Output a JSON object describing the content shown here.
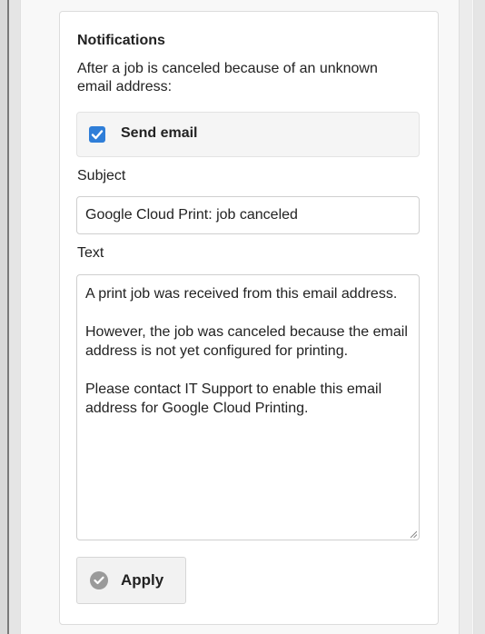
{
  "notifications": {
    "heading": "Notifications",
    "intro": "After a job is canceled because of an unknown email address:",
    "send_email": {
      "label": "Send email",
      "checked": true
    },
    "subject": {
      "label": "Subject",
      "value": "Google Cloud Print: job canceled"
    },
    "text": {
      "label": "Text",
      "paragraphs": [
        "A print job was received from this email address.",
        "However, the job was canceled because the email address is not yet configured for printing.",
        "Please contact IT Support to enable this email address for Google Cloud Printing."
      ]
    },
    "apply_label": "Apply"
  },
  "icons": {
    "checkbox": "check-icon",
    "apply": "check-circle-icon",
    "resize": "resize-grip-icon"
  },
  "colors": {
    "checkbox": "#2f7ed8",
    "apply_icon": "#9a9a9a"
  }
}
